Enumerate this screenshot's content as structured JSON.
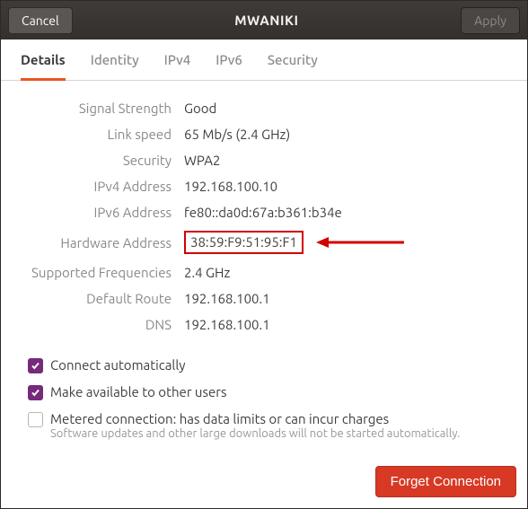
{
  "header": {
    "cancel": "Cancel",
    "title": "MWANIKI",
    "apply": "Apply"
  },
  "tabs": {
    "details": "Details",
    "identity": "Identity",
    "ipv4": "IPv4",
    "ipv6": "IPv6",
    "security": "Security"
  },
  "details": {
    "signal_label": "Signal Strength",
    "signal_value": "Good",
    "link_label": "Link speed",
    "link_value": "65 Mb/s (2.4 GHz)",
    "security_label": "Security",
    "security_value": "WPA2",
    "ipv4_label": "IPv4 Address",
    "ipv4_value": "192.168.100.10",
    "ipv6_label": "IPv6 Address",
    "ipv6_value": "fe80::da0d:67a:b361:b34e",
    "hw_label": "Hardware Address",
    "hw_value": "38:59:F9:51:95:F1",
    "freq_label": "Supported Frequencies",
    "freq_value": "2.4 GHz",
    "route_label": "Default Route",
    "route_value": "192.168.100.1",
    "dns_label": "DNS",
    "dns_value": "192.168.100.1"
  },
  "checks": {
    "auto_connect": "Connect automatically",
    "available_all": "Make available to other users",
    "metered": "Metered connection: has data limits or can incur charges",
    "metered_sub": "Software updates and other large downloads will not be started automatically."
  },
  "footer": {
    "forget": "Forget Connection"
  }
}
